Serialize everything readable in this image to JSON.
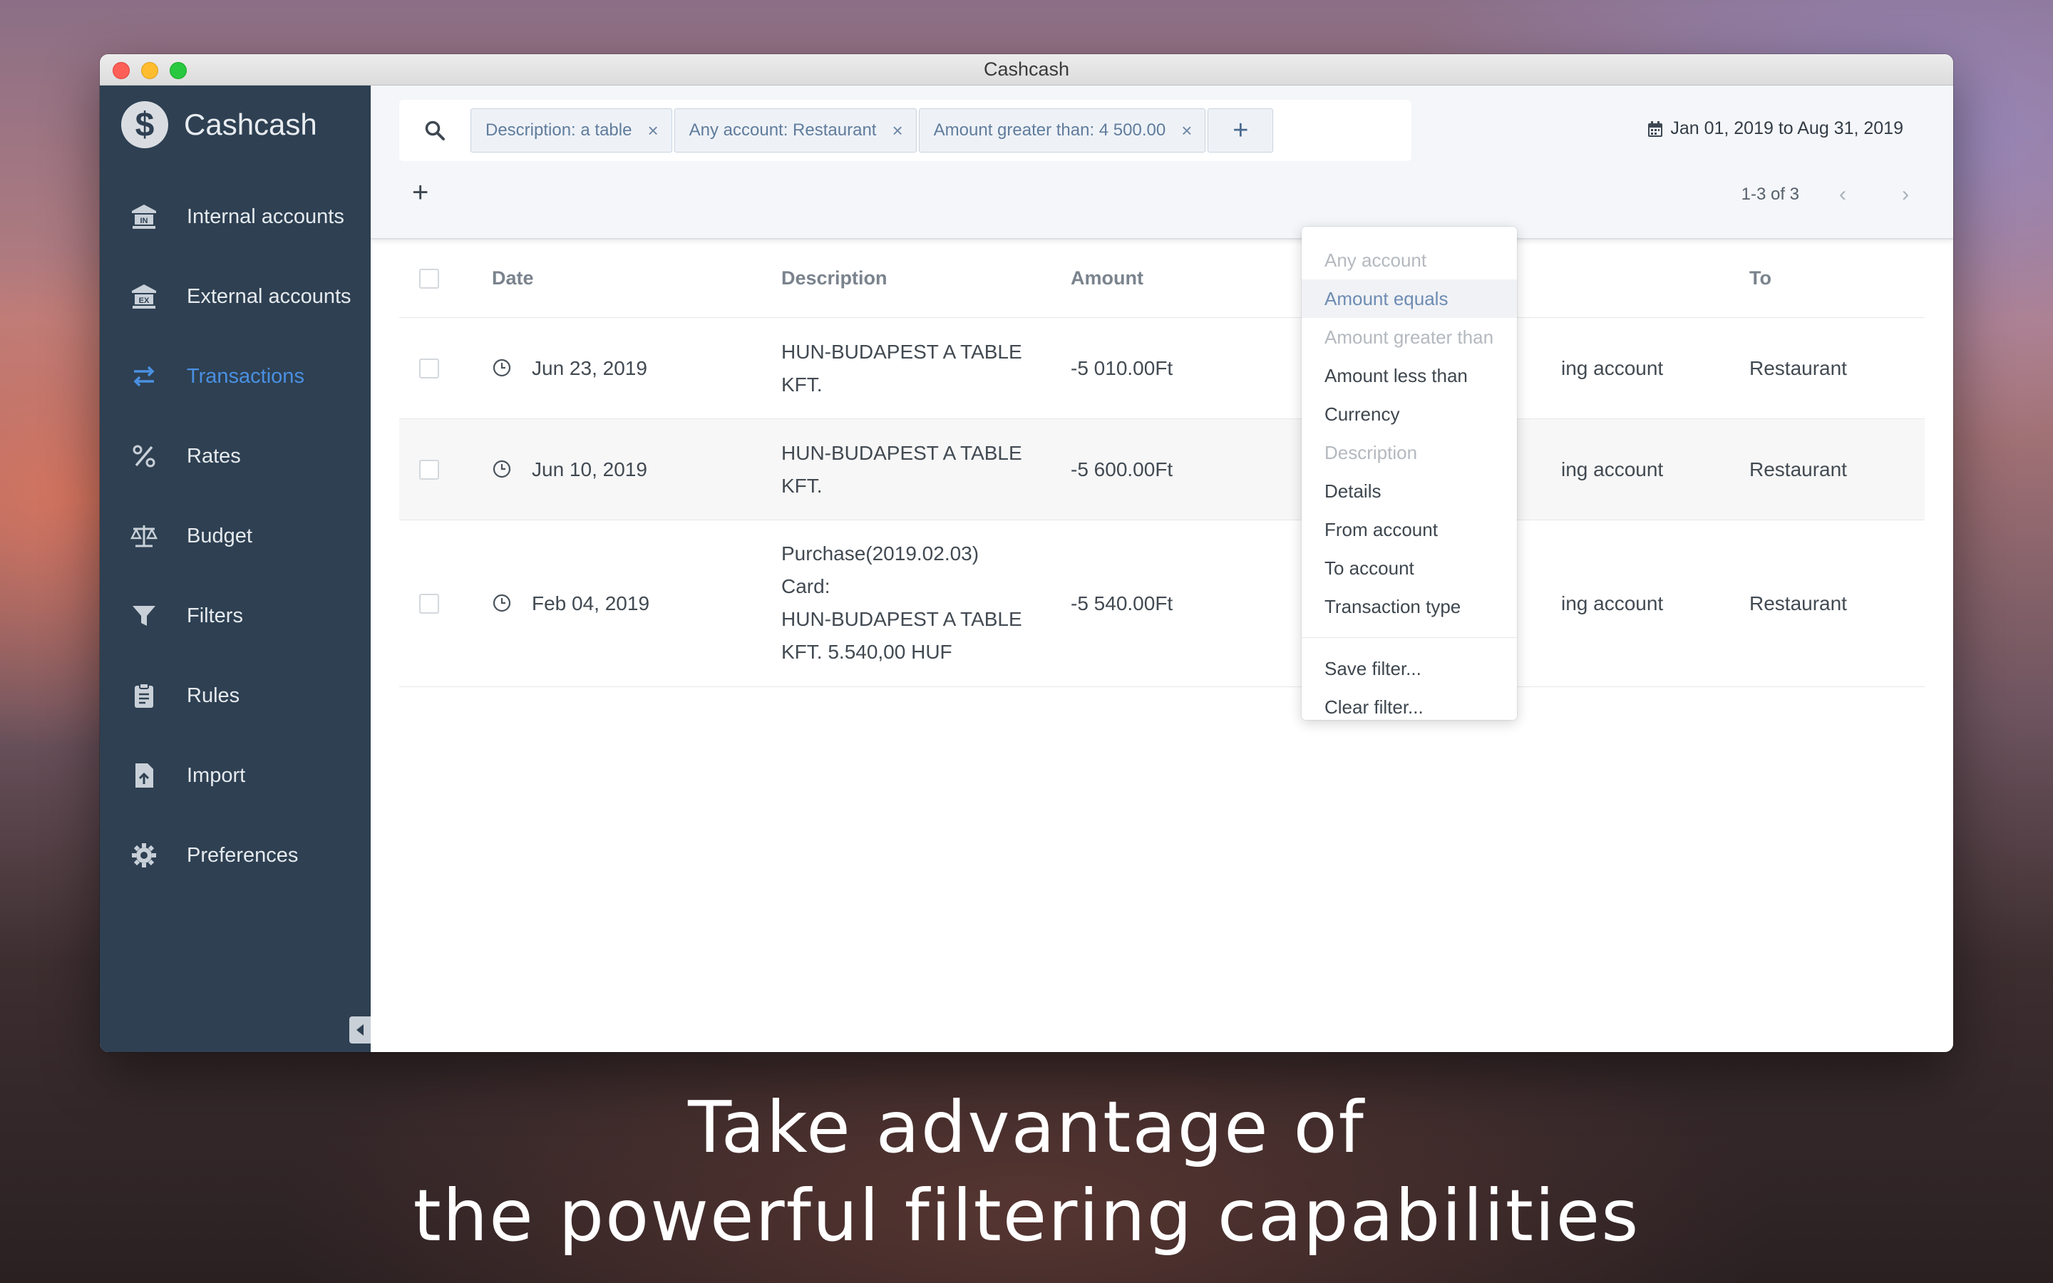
{
  "window": {
    "title": "Cashcash"
  },
  "sidebar": {
    "brand": "Cashcash",
    "brand_glyph": "$",
    "items": [
      {
        "label": "Internal accounts",
        "icon": "bank-in-icon",
        "active": false
      },
      {
        "label": "External accounts",
        "icon": "bank-ex-icon",
        "active": false
      },
      {
        "label": "Transactions",
        "icon": "transfer-arrows-icon",
        "active": true
      },
      {
        "label": "Rates",
        "icon": "percent-icon",
        "active": false
      },
      {
        "label": "Budget",
        "icon": "scale-icon",
        "active": false
      },
      {
        "label": "Filters",
        "icon": "filter-icon",
        "active": false
      },
      {
        "label": "Rules",
        "icon": "clipboard-icon",
        "active": false
      },
      {
        "label": "Import",
        "icon": "file-upload-icon",
        "active": false
      },
      {
        "label": "Preferences",
        "icon": "gear-icon",
        "active": false
      }
    ]
  },
  "filters": {
    "chips": [
      {
        "label": "Description: a table"
      },
      {
        "label": "Any account: Restaurant"
      },
      {
        "label": "Amount greater than: 4 500.00"
      }
    ],
    "add_label": "+"
  },
  "date_range": "Jan 01, 2019 to Aug 31, 2019",
  "toolbar": {
    "add_label": "+"
  },
  "pager": {
    "text": "1-3 of 3",
    "prev": "‹",
    "next": "›"
  },
  "table": {
    "columns": {
      "date": "Date",
      "description": "Description",
      "amount": "Amount",
      "to": "To"
    },
    "rows": [
      {
        "date": "Jun 23, 2019",
        "description": [
          "HUN-BUDAPEST A TABLE",
          "KFT."
        ],
        "amount": "-5 010.00Ft",
        "from": "ing account",
        "to": "Restaurant"
      },
      {
        "date": "Jun 10, 2019",
        "description": [
          "HUN-BUDAPEST A TABLE",
          "KFT."
        ],
        "amount": "-5 600.00Ft",
        "from": "ing account",
        "to": "Restaurant"
      },
      {
        "date": "Feb 04, 2019",
        "description": [
          "Purchase(2019.02.03)",
          "Card:",
          "HUN-BUDAPEST A TABLE",
          "KFT. 5.540,00 HUF"
        ],
        "amount": "-5 540.00Ft",
        "from": "ing account",
        "to": "Restaurant"
      }
    ]
  },
  "dropdown": {
    "items": [
      {
        "label": "Any account",
        "state": "disabled"
      },
      {
        "label": "Amount equals",
        "state": "hover"
      },
      {
        "label": "Amount greater than",
        "state": "disabled"
      },
      {
        "label": "Amount less than",
        "state": "normal"
      },
      {
        "label": "Currency",
        "state": "normal"
      },
      {
        "label": "Description",
        "state": "disabled"
      },
      {
        "label": "Details",
        "state": "normal"
      },
      {
        "label": "From account",
        "state": "normal"
      },
      {
        "label": "To account",
        "state": "normal"
      },
      {
        "label": "Transaction type",
        "state": "normal"
      }
    ],
    "actions": [
      {
        "label": "Save filter..."
      },
      {
        "label": "Clear filter..."
      }
    ]
  },
  "caption": {
    "line1": "Take advantage of",
    "line2": "the powerful filtering capabilities"
  },
  "colors": {
    "sidebar_bg": "#2e4052",
    "accent": "#4a90e2",
    "chip_text": "#607c9c"
  }
}
